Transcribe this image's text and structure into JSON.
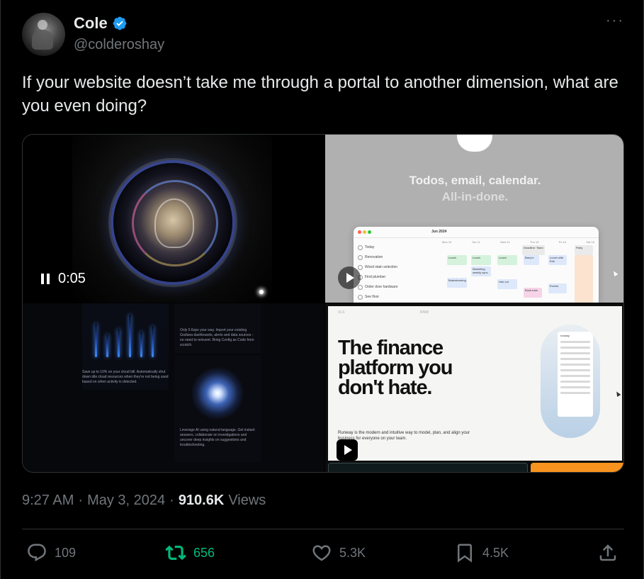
{
  "author": {
    "name": "Cole",
    "handle": "@colderoshay",
    "verified": true
  },
  "tweet": {
    "text": "If your website doesn’t take me through a portal to another dimension, what are you even doing?"
  },
  "media": {
    "video1": {
      "time": "0:05",
      "state": "playing"
    },
    "video2": {
      "headline_1": "Todos, email, calendar.",
      "headline_2": "All-in-done.",
      "app": {
        "sidebar_items": [
          "Today",
          "Renovation",
          "Wood stain selection",
          "Find plumber",
          "Order door hardware",
          "See floor"
        ],
        "month_label": "Jun 2024",
        "day_headers": [
          "Mon 10",
          "Tue 11",
          "Wed 11",
          "Thu 13",
          "Fri 14",
          "Sat 15"
        ],
        "events": [
          "Lunch",
          "Lunch",
          "Lunch",
          "Barry's",
          "Lunch with Erik",
          "Deadline: Team",
          "Marketing weekly sync",
          "Hair cut",
          "Brainstorming",
          "Party",
          "Book train",
          "Events"
        ]
      }
    },
    "video3": {
      "caption_a": "Save up to 10% on your cloud bill. Automatically shut down idle cloud resources when they're not being used based on when activity is detected.",
      "caption_b": "Only 0.6ops your way. Import your existing Grafana dashboards, alerts and data sources - no need to reinvent. Bring Config as Code from scratch.",
      "caption_c": "Leverage AI using natural language. Get instant answers, collaborate on investigations and uncover deep insights on suggestions and troubleshooting."
    },
    "video4": {
      "top_left": "XLS",
      "top_right": "RNW",
      "headline": "The finance platform you don't hate.",
      "subtext": "Runway is the modern and intuitive way to model, plan, and align your business for everyone on your team.",
      "app_label": "runway"
    }
  },
  "meta": {
    "time": "9:27 AM",
    "separator_1": "·",
    "date": "May 3, 2024",
    "separator_2": "·",
    "views_count": "910.6K",
    "views_label": "Views"
  },
  "actions": {
    "reply_count": "109",
    "retweet_count": "656",
    "like_count": "5.3K",
    "bookmark_count": "4.5K"
  },
  "colors": {
    "background": "#000000",
    "text": "#e7e9ea",
    "muted": "#71767b",
    "verified": "#1d9bf0",
    "retweet_active": "#00ba7c",
    "border": "#2f3336"
  }
}
